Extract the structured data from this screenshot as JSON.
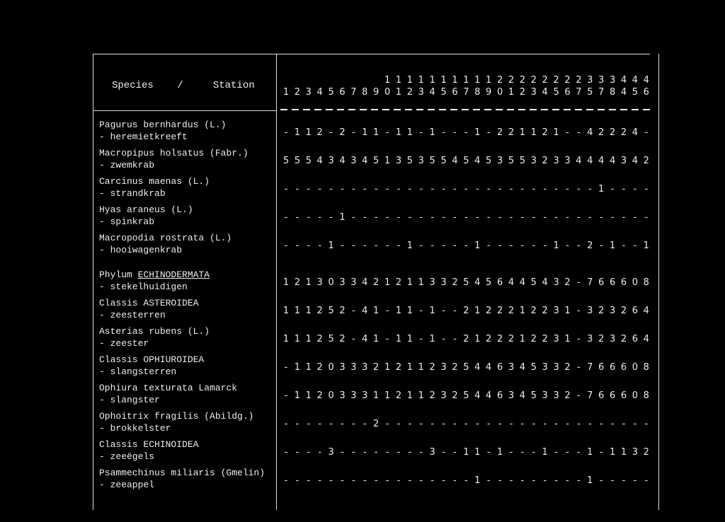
{
  "header": {
    "label": "Species    /     Station",
    "stations": [
      "1",
      "2",
      "3",
      "4",
      "5",
      "6",
      "7",
      "8",
      "9",
      "10",
      "11",
      "12",
      "13",
      "14",
      "15",
      "16",
      "17",
      "18",
      "19",
      "20",
      "21",
      "22",
      "23",
      "24",
      "25",
      "26",
      "27",
      "35",
      "37",
      "38",
      "44",
      "45",
      "46"
    ]
  },
  "rows": [
    {
      "latin": "Pagurus bernhardus (L.)",
      "common": "- heremietkreeft",
      "underline": "",
      "values": [
        "-",
        "1",
        "1",
        "2",
        "-",
        "2",
        "-",
        "1",
        "1",
        "-",
        "1",
        "1",
        "-",
        "1",
        "-",
        "-",
        "-",
        "1",
        "-",
        "2",
        "2",
        "1",
        "1",
        "2",
        "1",
        "-",
        "-",
        "4",
        "2",
        "2",
        "2",
        "4",
        "-"
      ]
    },
    {
      "latin": "Macropipus holsatus (Fabr.)",
      "common": "- zwemkrab",
      "underline": "",
      "values": [
        "5",
        "5",
        "5",
        "4",
        "3",
        "4",
        "3",
        "4",
        "5",
        "1",
        "3",
        "5",
        "3",
        "5",
        "5",
        "4",
        "5",
        "4",
        "5",
        "3",
        "5",
        "5",
        "3",
        "2",
        "3",
        "3",
        "4",
        "4",
        "4",
        "4",
        "3",
        "4",
        "2"
      ]
    },
    {
      "latin": "Carcinus maenas (L.)",
      "common": "- strandkrab",
      "underline": "",
      "values": [
        "-",
        "-",
        "-",
        "-",
        "-",
        "-",
        "-",
        "-",
        "-",
        "-",
        "-",
        "-",
        "-",
        "-",
        "-",
        "-",
        "-",
        "-",
        "-",
        "-",
        "-",
        "-",
        "-",
        "-",
        "-",
        "-",
        "-",
        "-",
        "1",
        "-",
        "-",
        "-",
        "-"
      ]
    },
    {
      "latin": "Hyas araneus (L.)",
      "common": "- spinkrab",
      "underline": "",
      "values": [
        "-",
        "-",
        "-",
        "-",
        "-",
        "1",
        "-",
        "-",
        "-",
        "-",
        "-",
        "-",
        "-",
        "-",
        "-",
        "-",
        "-",
        "-",
        "-",
        "-",
        "-",
        "-",
        "-",
        "-",
        "-",
        "-",
        "-",
        "-",
        "-",
        "-",
        "-",
        "-",
        "-"
      ]
    },
    {
      "latin": "Macropodia rostrata (L.)",
      "common": "- hooiwagenkrab",
      "underline": "",
      "values": [
        "-",
        "-",
        "-",
        "-",
        "1",
        "-",
        "-",
        "-",
        "-",
        "-",
        "-",
        "1",
        "-",
        "-",
        "-",
        "-",
        "-",
        "1",
        "-",
        "-",
        "-",
        "-",
        "-",
        "-",
        "1",
        "-",
        "-",
        "2",
        "-",
        "1",
        "-",
        "-",
        "1"
      ]
    },
    {
      "latin": "Phylum ",
      "common": "- stekelhuidigen",
      "underline": "ECHINODERMATA",
      "values": [
        "1",
        "2",
        "1",
        "3",
        "0",
        "3",
        "3",
        "4",
        "2",
        "1",
        "2",
        "1",
        "1",
        "3",
        "3",
        "2",
        "5",
        "4",
        "5",
        "6",
        "4",
        "4",
        "5",
        "4",
        "3",
        "2",
        "-",
        "7",
        "6",
        "6",
        "6",
        "0",
        "8"
      ]
    },
    {
      "latin": "Classis ASTEROIDEA",
      "common": "- zeesterren",
      "underline": "",
      "values": [
        "1",
        "1",
        "1",
        "2",
        "5",
        "2",
        "-",
        "4",
        "1",
        "-",
        "1",
        "1",
        "-",
        "1",
        "-",
        "-",
        "2",
        "1",
        "2",
        "2",
        "2",
        "1",
        "2",
        "2",
        "3",
        "1",
        "-",
        "3",
        "2",
        "3",
        "2",
        "6",
        "4"
      ]
    },
    {
      "latin": "Asterias rubens (L.)",
      "common": "- zeester",
      "underline": "",
      "values": [
        "1",
        "1",
        "1",
        "2",
        "5",
        "2",
        "-",
        "4",
        "1",
        "-",
        "1",
        "1",
        "-",
        "1",
        "-",
        "-",
        "2",
        "1",
        "2",
        "2",
        "2",
        "1",
        "2",
        "2",
        "3",
        "1",
        "-",
        "3",
        "2",
        "3",
        "2",
        "6",
        "4"
      ]
    },
    {
      "latin": "Classis OPHIUROIDEA",
      "common": "- slangsterren",
      "underline": "",
      "values": [
        "-",
        "1",
        "1",
        "2",
        "0",
        "3",
        "3",
        "3",
        "2",
        "1",
        "2",
        "1",
        "1",
        "2",
        "3",
        "2",
        "5",
        "4",
        "4",
        "6",
        "3",
        "4",
        "5",
        "3",
        "3",
        "2",
        "-",
        "7",
        "6",
        "6",
        "6",
        "0",
        "8"
      ]
    },
    {
      "latin": "Ophiura texturata Lamarck",
      "common": "- slangster",
      "underline": "",
      "values": [
        "-",
        "1",
        "1",
        "2",
        "0",
        "3",
        "3",
        "3",
        "1",
        "1",
        "2",
        "1",
        "1",
        "2",
        "3",
        "2",
        "5",
        "4",
        "4",
        "6",
        "3",
        "4",
        "5",
        "3",
        "3",
        "2",
        "-",
        "7",
        "6",
        "6",
        "6",
        "0",
        "8"
      ]
    },
    {
      "latin": "Ophoitrix fragilis (Abildg.)",
      "common": "- brokkelster",
      "underline": "",
      "values": [
        "-",
        "-",
        "-",
        "-",
        "-",
        "-",
        "-",
        "-",
        "2",
        "-",
        "-",
        "-",
        "-",
        "-",
        "-",
        "-",
        "-",
        "-",
        "-",
        "-",
        "-",
        "-",
        "-",
        "-",
        "-",
        "-",
        "-",
        "-",
        "-",
        "-",
        "-",
        "-",
        "-"
      ]
    },
    {
      "latin": "Classis ECHINOIDEA",
      "common": "- zeeëgels",
      "underline": "",
      "values": [
        "-",
        "-",
        "-",
        "-",
        "3",
        "-",
        "-",
        "-",
        "-",
        "-",
        "-",
        "-",
        "-",
        "3",
        "-",
        "-",
        "1",
        "1",
        "-",
        "1",
        "-",
        "-",
        "-",
        "1",
        "-",
        "-",
        "-",
        "1",
        "-",
        "1",
        "1",
        "3",
        "2"
      ]
    },
    {
      "latin": "Psammechinus miliaris (Gmelin)",
      "common": "- zeeappel",
      "underline": "",
      "values": [
        "-",
        "-",
        "-",
        "-",
        "-",
        "-",
        "-",
        "-",
        "-",
        "-",
        "-",
        "-",
        "-",
        "-",
        "-",
        "-",
        "-",
        "1",
        "-",
        "-",
        "-",
        "-",
        "-",
        "-",
        "-",
        "-",
        "-",
        "1",
        "-",
        "-",
        "-",
        "-",
        "-"
      ]
    }
  ]
}
